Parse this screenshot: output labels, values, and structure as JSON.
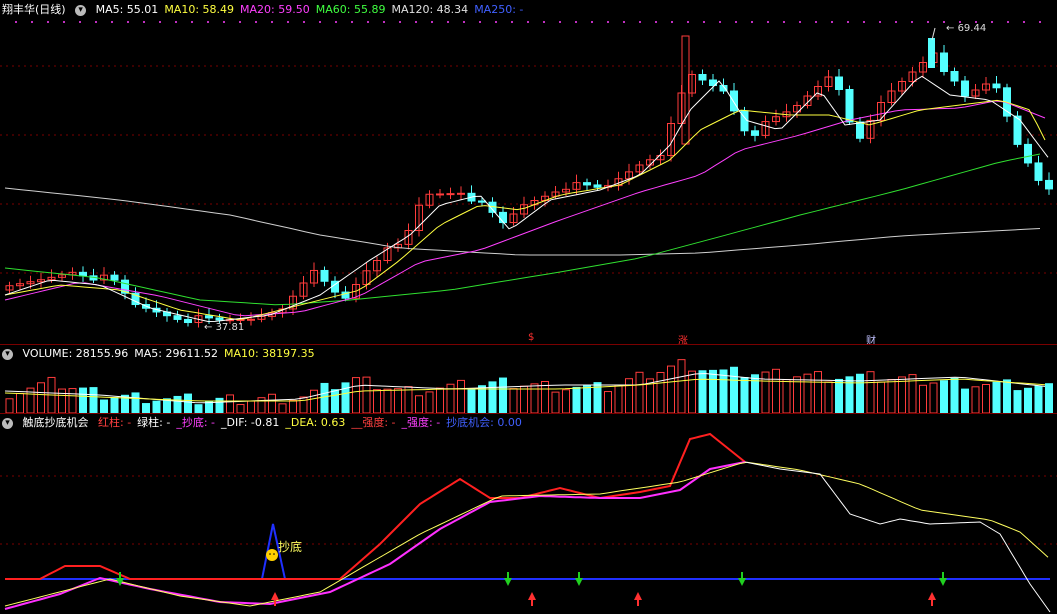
{
  "price_panel": {
    "stock_name": "翔丰华(日线)",
    "ma": [
      {
        "label": "MA5: 55.01",
        "color": "#ffffff"
      },
      {
        "label": "MA10: 58.49",
        "color": "#ffff40"
      },
      {
        "label": "MA20: 59.50",
        "color": "#ff40ff"
      },
      {
        "label": "MA60: 55.89",
        "color": "#40ff40"
      },
      {
        "label": "MA120: 48.34",
        "color": "#e0e0e0"
      },
      {
        "label": "MA250: -",
        "color": "#4060ff"
      }
    ],
    "high_label": "69.44",
    "low_label": "37.81",
    "event_tags": [
      {
        "label": "$",
        "color": "#ff3030"
      },
      {
        "label": "涨",
        "color": "#ff3030"
      },
      {
        "label": "财",
        "color": "#c0c0ff"
      }
    ]
  },
  "volume_panel": {
    "labels": [
      {
        "label": "VOLUME: 28155.96",
        "color": "#ffffff"
      },
      {
        "label": "MA5: 29611.52",
        "color": "#ffffff"
      },
      {
        "label": "MA10: 38197.35",
        "color": "#ffff40"
      }
    ]
  },
  "indicator_panel": {
    "title": "触底抄底机会",
    "labels": [
      {
        "label": "红柱: -",
        "color": "#ff4040"
      },
      {
        "label": "绿柱: -",
        "color": "#ffffff"
      },
      {
        "label": "_抄底: -",
        "color": "#ff40ff"
      },
      {
        "label": "_DIF: -0.81",
        "color": "#ffffff"
      },
      {
        "label": "_DEA: 0.63",
        "color": "#ffff40"
      },
      {
        "label": "__强度: -",
        "color": "#ff4040"
      },
      {
        "label": "_强度: -",
        "color": "#ff40ff"
      },
      {
        "label": "抄底机会: 0.00",
        "color": "#4060ff"
      }
    ],
    "bottom_label": "抄底"
  }
}
